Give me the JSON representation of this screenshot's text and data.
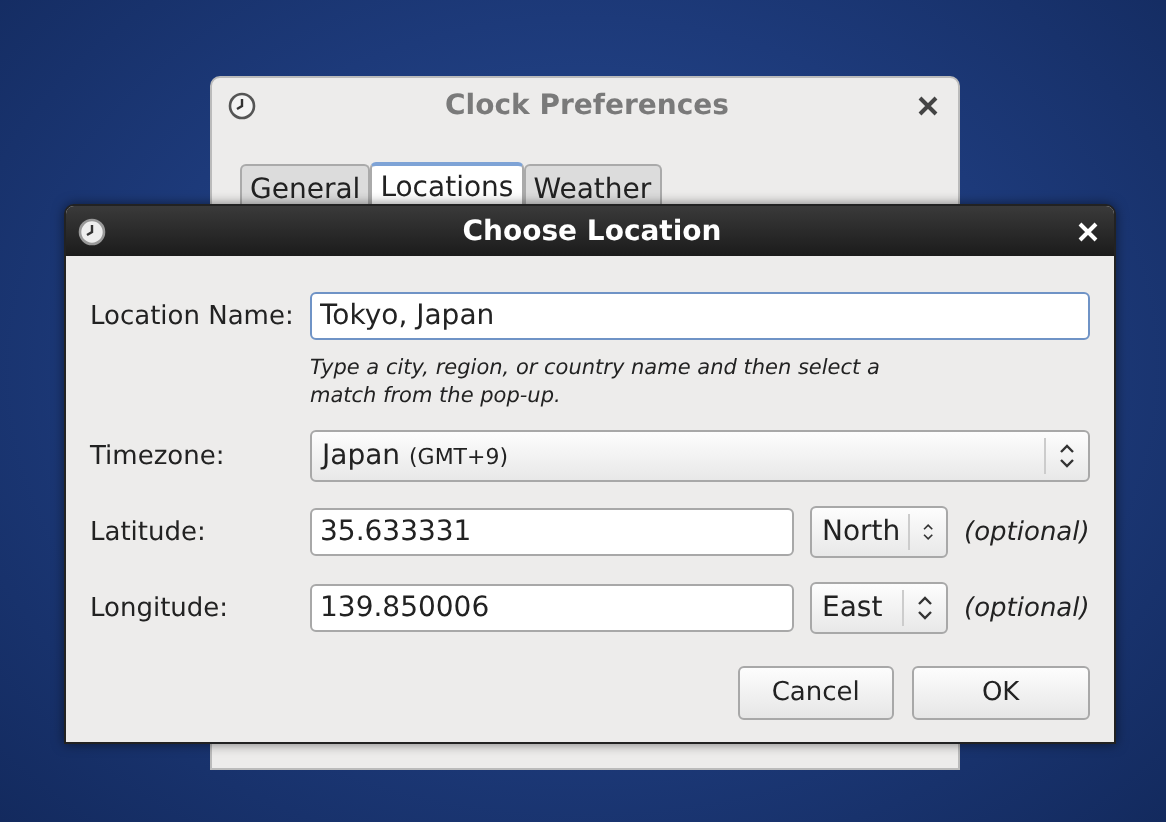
{
  "background_window": {
    "title": "Clock Preferences",
    "tabs": [
      {
        "label": "General",
        "selected": false
      },
      {
        "label": "Locations",
        "selected": true
      },
      {
        "label": "Weather",
        "selected": false
      }
    ]
  },
  "dialog": {
    "title": "Choose Location",
    "location_name": {
      "label": "Location Name:",
      "value": "Tokyo, Japan",
      "focused": true,
      "hint": "Type a city, region, or country name and then select a match from the pop-up."
    },
    "timezone": {
      "label": "Timezone:",
      "value": "Japan",
      "offset": "(GMT+9)"
    },
    "latitude": {
      "label": "Latitude:",
      "value": "35.633331",
      "direction": "North",
      "note": "(optional)"
    },
    "longitude": {
      "label": "Longitude:",
      "value": "139.850006",
      "direction": "East",
      "note": "(optional)"
    },
    "buttons": [
      "Cancel",
      "OK"
    ]
  }
}
